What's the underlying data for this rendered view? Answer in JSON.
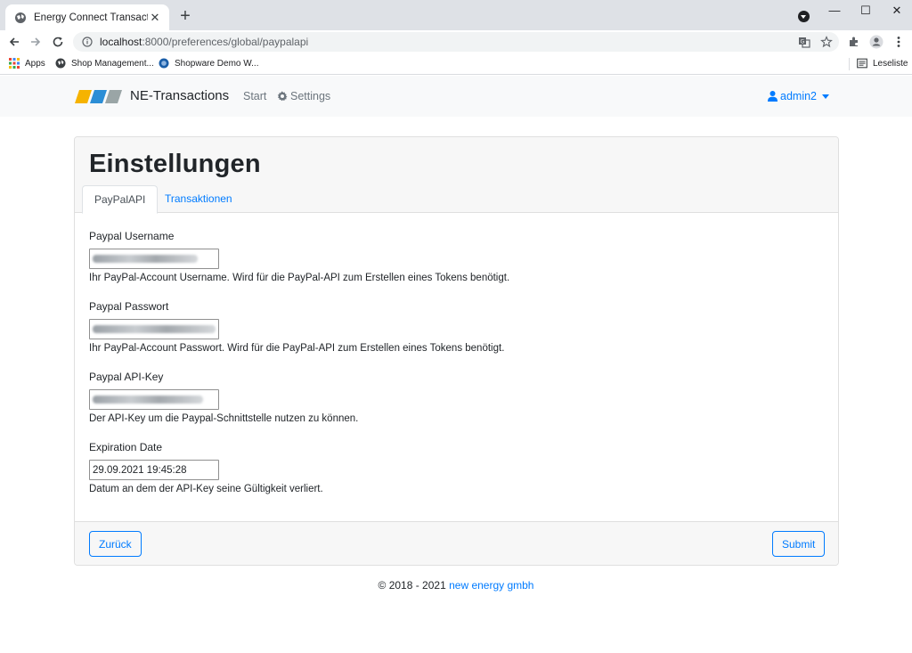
{
  "browser": {
    "tab_title": "Energy Connect Transactions",
    "url_host": "localhost",
    "url_path": ":8000/preferences/global/paypalapi",
    "bookmarks": {
      "apps": "Apps",
      "shop_management": "Shop Management...",
      "shopware_demo": "Shopware Demo W...",
      "reading_list": "Leseliste"
    }
  },
  "navbar": {
    "brand": "NE-Transactions",
    "start": "Start",
    "settings": "Settings",
    "user": "admin2",
    "logo_colors": [
      "#f6b300",
      "#2c8ed6",
      "#9aa5a6"
    ]
  },
  "page": {
    "title": "Einstellungen",
    "tabs": [
      {
        "label": "PayPalAPI",
        "active": true
      },
      {
        "label": "Transaktionen",
        "active": false
      }
    ],
    "fields": [
      {
        "label": "Paypal Username",
        "value_hidden": true,
        "help": "Ihr PayPal-Account Username. Wird für die PayPal-API zum Erstellen eines Tokens benötigt."
      },
      {
        "label": "Paypal Passwort",
        "value_hidden": true,
        "help": "Ihr PayPal-Account Passwort. Wird für die PayPal-API zum Erstellen eines Tokens benötigt."
      },
      {
        "label": "Paypal API-Key",
        "value_hidden": true,
        "help": "Der API-Key um die Paypal-Schnittstelle nutzen zu können."
      },
      {
        "label": "Expiration Date",
        "value": "29.09.2021 19:45:28",
        "help": "Datum an dem der API-Key seine Gültigkeit verliert."
      }
    ],
    "buttons": {
      "back": "Zurück",
      "submit": "Submit"
    }
  },
  "footer": {
    "copyright": "© 2018 - 2021",
    "company": "new energy gmbh"
  },
  "colors": {
    "primary": "#007bff",
    "muted": "#6c757d"
  }
}
